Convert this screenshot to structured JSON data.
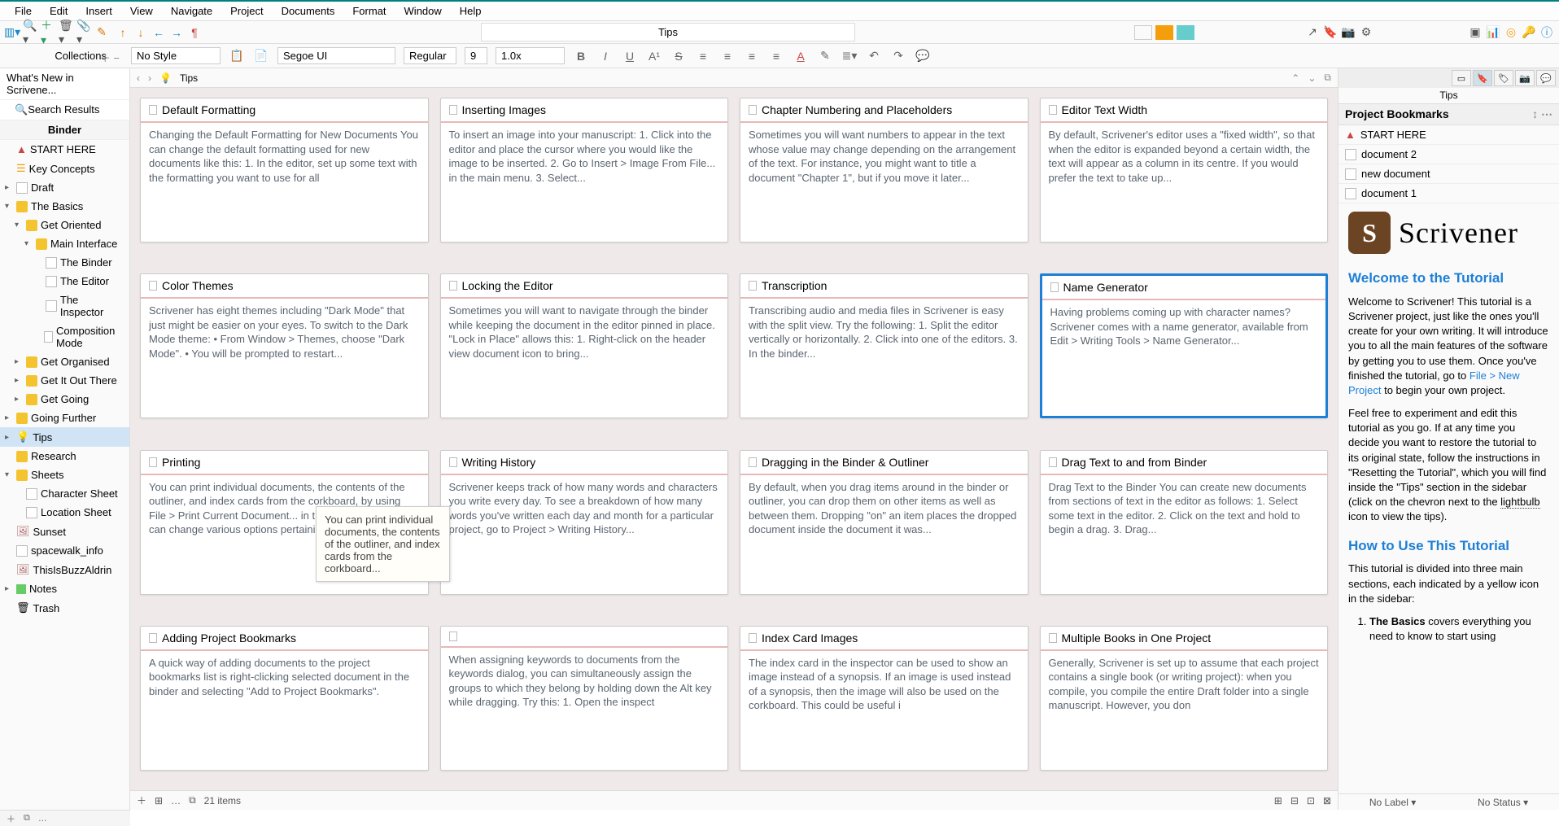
{
  "menus": [
    "File",
    "Edit",
    "Insert",
    "View",
    "Navigate",
    "Project",
    "Documents",
    "Format",
    "Window",
    "Help"
  ],
  "toolbar": {
    "doc_title": "Tips"
  },
  "collections_label": "Collections",
  "format": {
    "style": "No Style",
    "font": "Segoe UI",
    "weight": "Regular",
    "size": "9",
    "spacing": "1.0x"
  },
  "collection_tabs": {
    "whats_new": "What's New in Scrivene...",
    "search": "Search Results",
    "binder": "Binder"
  },
  "binder": [
    {
      "label": "START HERE",
      "icon": "red-triangle",
      "indent": 0
    },
    {
      "label": "Key Concepts",
      "icon": "orange",
      "indent": 0
    },
    {
      "label": "Draft",
      "icon": "doc",
      "indent": 0,
      "chev": "right"
    },
    {
      "label": "The Basics",
      "icon": "folder",
      "indent": 0,
      "chev": "down"
    },
    {
      "label": "Get Oriented",
      "icon": "folder",
      "indent": 1,
      "chev": "down"
    },
    {
      "label": "Main Interface",
      "icon": "folder",
      "indent": 2,
      "chev": "down"
    },
    {
      "label": "The Binder",
      "icon": "doc",
      "indent": 3
    },
    {
      "label": "The Editor",
      "icon": "doc",
      "indent": 3
    },
    {
      "label": "The Inspector",
      "icon": "doc",
      "indent": 3
    },
    {
      "label": "Composition Mode",
      "icon": "doc",
      "indent": 3
    },
    {
      "label": "Get Organised",
      "icon": "folder",
      "indent": 1,
      "chev": "right"
    },
    {
      "label": "Get It Out There",
      "icon": "folder",
      "indent": 1,
      "chev": "right"
    },
    {
      "label": "Get Going",
      "icon": "folder",
      "indent": 1,
      "chev": "right"
    },
    {
      "label": "Going Further",
      "icon": "folder",
      "indent": 0,
      "chev": "right"
    },
    {
      "label": "Tips",
      "icon": "bulb",
      "indent": 0,
      "chev": "right",
      "selected": true
    },
    {
      "label": "Research",
      "icon": "folder",
      "indent": 0
    },
    {
      "label": "Sheets",
      "icon": "folder",
      "indent": 0,
      "chev": "down"
    },
    {
      "label": "Character Sheet",
      "icon": "doc",
      "indent": 1
    },
    {
      "label": "Location Sheet",
      "icon": "doc",
      "indent": 1
    },
    {
      "label": "Sunset",
      "icon": "image",
      "indent": 0
    },
    {
      "label": "spacewalk_info",
      "icon": "doc",
      "indent": 0
    },
    {
      "label": "ThisIsBuzzAldrin",
      "icon": "image",
      "indent": 0
    },
    {
      "label": "Notes",
      "icon": "green",
      "indent": 0,
      "chev": "right"
    },
    {
      "label": "Trash",
      "icon": "trash",
      "indent": 0
    }
  ],
  "editor": {
    "breadcrumb_icon": "bulb",
    "breadcrumb": "Tips",
    "item_count": "21 items",
    "no_label": "No Label",
    "no_status": "No Status"
  },
  "cards": [
    {
      "title": "Default Formatting",
      "body": "Changing the Default Formatting for New Documents You can change the default formatting used for new documents like this: 1. In the editor, set up some text with the formatting you want to use for all"
    },
    {
      "title": "Inserting Images",
      "body": "To insert an image into your manuscript: 1. Click into the editor and place the cursor where you would like the image to be inserted. 2. Go to Insert > Image From File... in the main menu. 3. Select..."
    },
    {
      "title": "Chapter Numbering and Placeholders",
      "body": "Sometimes you will want numbers to appear in the text whose value may change depending on the arrangement of the text. For instance, you might want to title a document \"Chapter 1\", but if you move it later..."
    },
    {
      "title": "Editor Text Width",
      "body": "By default, Scrivener's editor uses a \"fixed width\", so that when the editor is expanded beyond a certain width, the text will appear as a column in its centre. If you would prefer the text to take up..."
    },
    {
      "title": "Color Themes",
      "body": "Scrivener has eight themes including \"Dark Mode\" that just might be easier on your eyes. To switch to the Dark Mode theme: • From Window > Themes, choose \"Dark Mode\". • You will be prompted to restart..."
    },
    {
      "title": "Locking the Editor",
      "body": "Sometimes you will want to navigate through the binder while keeping the document in the editor pinned in place. \"Lock in Place\" allows this: 1. Right-click on the header view document icon to bring..."
    },
    {
      "title": "Transcription",
      "body": "Transcribing audio and media files in Scrivener is easy with the split view. Try the following: 1. Split the editor vertically or horizontally. 2. Click into one of the editors. 3. In the binder..."
    },
    {
      "title": "Name Generator",
      "body": "Having problems coming up with character names? Scrivener comes with a name generator, available from Edit > Writing Tools > Name Generator...",
      "selected": true
    },
    {
      "title": "Printing",
      "body": "You can print individual documents, the contents of the outliner, and index cards from the corkboard, by using File > Print Current Document... in the main menu. You can change various options pertaining..."
    },
    {
      "title": "Writing History",
      "body": "Scrivener keeps track of how many words and characters you write every day. To see a breakdown of how many words you've written each day and month for a particular project, go to Project > Writing History..."
    },
    {
      "title": "Dragging in the Binder & Outliner",
      "body": "By default, when you drag items around in the binder or outliner, you can drop them on other items as well as between them. Dropping \"on\" an item places the dropped document inside the document it was..."
    },
    {
      "title": "Drag Text to and from Binder",
      "body": "Drag Text to the Binder You can create new documents from sections of text in the editor as follows: 1. Select some text in the editor. 2. Click on the text and hold to begin a drag. 3. Drag..."
    },
    {
      "title": "Adding Project Bookmarks",
      "body": "A quick way of adding documents to the project bookmarks list is right-clicking selected document in the binder and selecting \"Add to Project Bookmarks\"."
    },
    {
      "title": "",
      "body": "When assigning keywords to documents from the keywords dialog, you can simultaneously assign the groups to which they belong by holding down the Alt key while dragging. Try this: 1. Open the inspect"
    },
    {
      "title": "Index Card Images",
      "body": "The index card in the inspector can be used to show an image instead of a synopsis. If an image is used instead of a synopsis, then the image will also be used on the corkboard. This could be useful i"
    },
    {
      "title": "Multiple Books in One Project",
      "body": "Generally, Scrivener is set up to assume that each project contains a single book (or writing project): when you compile, you compile the entire Draft folder into a single manuscript. However, you don"
    }
  ],
  "tooltip": "You can print individual documents, the contents of the outliner, and index cards from the corkboard...",
  "inspector": {
    "tab_title": "Tips",
    "section": "Project Bookmarks",
    "bookmarks": [
      {
        "label": "START HERE",
        "icon": "red"
      },
      {
        "label": "document 2",
        "icon": "doc"
      },
      {
        "label": "new document",
        "icon": "doc"
      },
      {
        "label": "document 1",
        "icon": "doc"
      }
    ],
    "logo_text": "Scrivener",
    "h1": "Welcome to the Tutorial",
    "p1a": "Welcome to Scrivener! This tutorial is a Scrivener project, just like the ones you'll create for your own writing. It will introduce you to all the main features of the software by getting you to use them. Once you've finished the tutorial, go to ",
    "p1_link": "File > New Project",
    "p1b": " to begin your own project.",
    "p2a": "Feel free to experiment and edit this tutorial as you go. If at any time you decide you want to restore the tutorial to its original state, follow the instructions in \"Resetting the Tutorial\", which you will find inside the \"Tips\" section in the sidebar (click on the chevron next to the ",
    "p2_under": "lightbulb",
    "p2b": " icon to view the tips).",
    "h2": "How to Use This Tutorial",
    "p3": "This tutorial is divided into three main sections, each indicated by a yellow icon in the sidebar:",
    "li1_bold": "The Basics",
    "li1_rest": " covers everything you need to know to start using",
    "no_label": "No Label",
    "no_status": "No Status"
  }
}
